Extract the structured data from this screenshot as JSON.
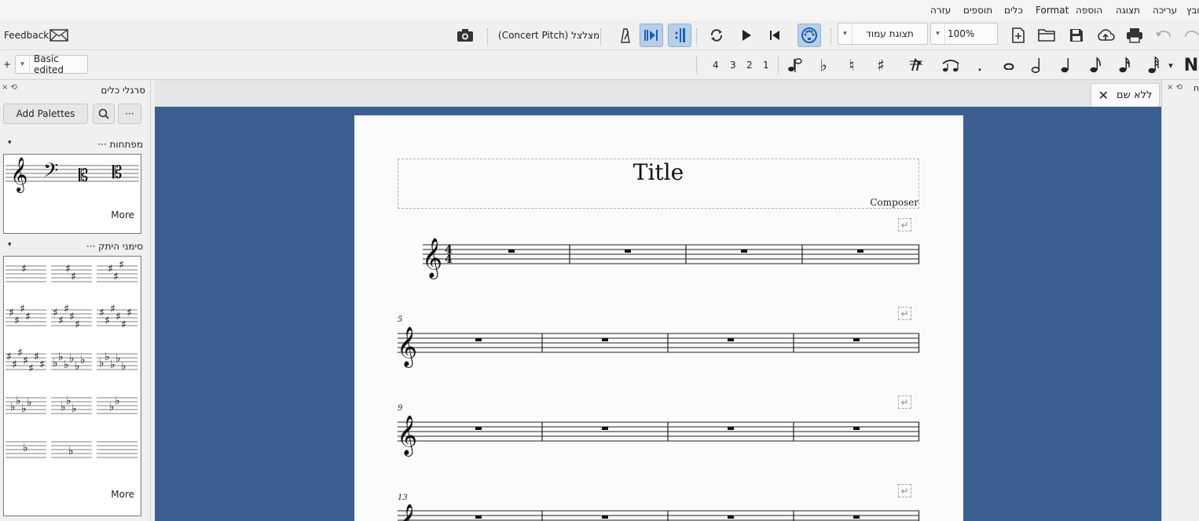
{
  "menu": {
    "items": [
      "קובץ",
      "עריכה",
      "תצוגה",
      "הוספה",
      "Format",
      "כלים",
      "תוספים",
      "עזרה"
    ]
  },
  "toolbar": {
    "feedback_label": "Feedback",
    "concert_pitch_label": "מצלצל (Concert Pitch)",
    "view_mode": "תצוגת עמוד",
    "zoom": "100%"
  },
  "note_input": {
    "workspace": "Basic edited",
    "voices": [
      "1",
      "2",
      "3",
      "4"
    ]
  },
  "palettes": {
    "title": "סרגלי כלים",
    "add_label": "Add Palettes",
    "clefs_title": "מפתחות",
    "keysig_title": "סימני היתק",
    "more_label": "More"
  },
  "score": {
    "tab_label": "ללא שם",
    "title": "Title",
    "composer": "Composer",
    "measure_numbers": [
      "5",
      "9",
      "13"
    ]
  },
  "colors": {
    "canvas": "#3a5f90",
    "page": "#fbfbfb",
    "active_button": "#b9cfe6"
  }
}
